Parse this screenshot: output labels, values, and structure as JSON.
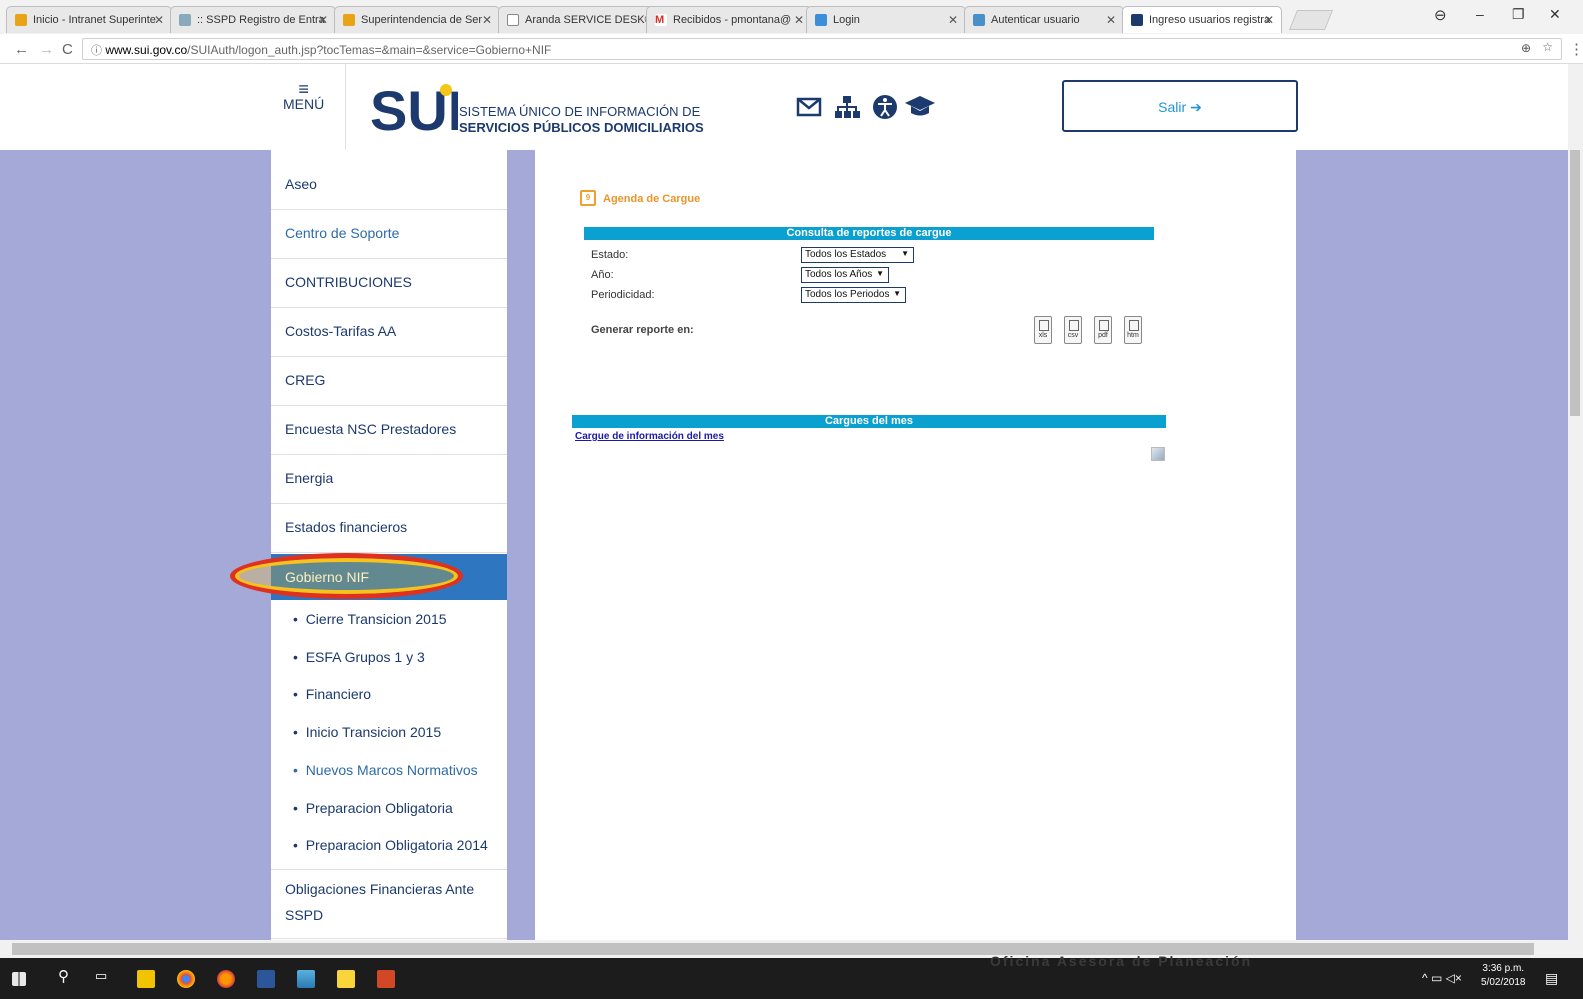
{
  "browser": {
    "tabs": [
      {
        "title": "Inicio - Intranet Superinte",
        "left": 0
      },
      {
        "title": ":: SSPD Registro de Entra",
        "left": 0
      },
      {
        "title": "Superintendencia de Ser",
        "left": 0
      },
      {
        "title": "Aranda SERVICE DESK®",
        "left": 0
      },
      {
        "title": "Recibidos - pmontana@",
        "left": 0
      },
      {
        "title": "Login",
        "left": 0
      },
      {
        "title": "Autenticar usuario",
        "left": 0
      },
      {
        "title": "Ingreso usuarios registra",
        "left": 0
      }
    ],
    "url_host": "www.sui.gov.co",
    "url_path": "/SUIAuth/logon_auth.jsp?tocTemas=&main=&service=Gobierno+NIF"
  },
  "header": {
    "menu_label": "MENÚ",
    "logo_text": "SUI",
    "title_line1": "SISTEMA ÚNICO DE INFORMACIÓN DE",
    "title_line2": "SERVICIOS PÚBLICOS DOMICILIARIOS",
    "salir_label": "Salir"
  },
  "sidebar": {
    "items": [
      "Aseo",
      "Centro de Soporte",
      "CONTRIBUCIONES",
      "Costos-Tarifas AA",
      "CREG",
      "Encuesta NSC Prestadores",
      "Energia",
      "Estados financieros",
      "Gobierno NIF"
    ],
    "subitems": [
      "Cierre Transicion 2015",
      "ESFA Grupos 1 y 3",
      "Financiero",
      "Inicio Transicion 2015",
      "Nuevos Marcos Normativos",
      "Preparacion Obligatoria",
      "Preparacion Obligatoria 2014"
    ],
    "last_item_line1": "Obligaciones Financieras Ante",
    "last_item_line2": "SSPD"
  },
  "main": {
    "agenda_icon": "9",
    "agenda_title": "Agenda de Cargue",
    "consulta_title": "Consulta de reportes de cargue",
    "estado_label": "Estado:",
    "estado_value": "Todos los Estados",
    "anio_label": "Año:",
    "anio_value": "Todos los Años",
    "periodicidad_label": "Periodicidad:",
    "periodicidad_value": "Todos los Periodos",
    "generar_label": "Generar reporte en:",
    "formats": [
      "xls",
      "csv",
      "pdf",
      "htm"
    ],
    "cargues_title": "Cargues del mes",
    "cargue_link": "Cargue de información del mes"
  },
  "taskbar": {
    "watermark": "Oficina Asesora de Planeación",
    "time": "3:36 p.m.",
    "date": "5/02/2018"
  }
}
